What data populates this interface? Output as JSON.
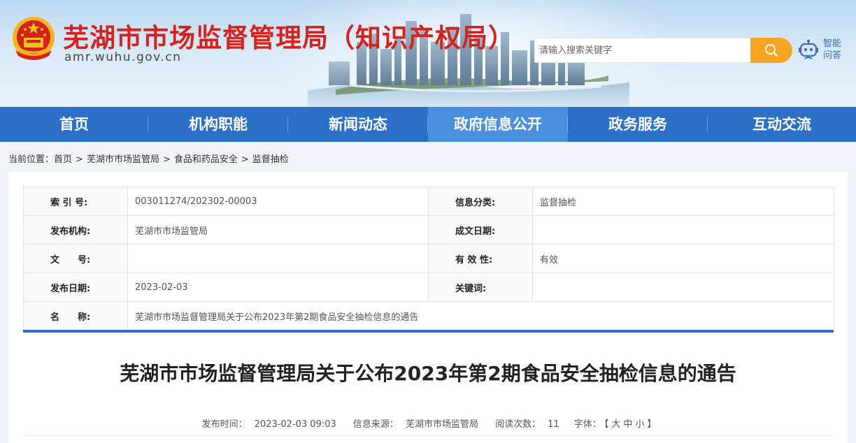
{
  "header": {
    "site_title": "芜湖市市场监督管理局（知识产权局）",
    "site_domain": "amr.wuhu.gov.cn",
    "search_placeholder": "请输入搜索关键字",
    "smart_qa_label": "智能问答",
    "icons": [
      "national-emblem-icon",
      "search-icon",
      "robot-icon"
    ]
  },
  "nav": {
    "items": [
      {
        "label": "首页"
      },
      {
        "label": "机构职能"
      },
      {
        "label": "新闻动态"
      },
      {
        "label": "政府信息公开",
        "active": true
      },
      {
        "label": "政务服务"
      },
      {
        "label": "互动交流"
      }
    ]
  },
  "breadcrumb": {
    "prefix": "当前位置：",
    "items": [
      "首页",
      "芜湖市市场监管局",
      "食品和药品安全",
      "监督抽检"
    ],
    "separator": ">"
  },
  "info_table": {
    "rows": [
      {
        "label1": "索 引 号:",
        "value1": "003011274/202302-00003",
        "label2": "信息分类:",
        "value2": "监督抽检"
      },
      {
        "label1": "发布机构:",
        "value1": "芜湖市市场监管局",
        "label2": "成文日期:",
        "value2": ""
      },
      {
        "label1": "文　　号:",
        "value1": "",
        "label2": "有 效 性:",
        "value2": "有效"
      },
      {
        "label1": "发布日期:",
        "value1": "2023-02-03",
        "label2": "关键词:",
        "value2": ""
      }
    ],
    "name_label": "名　　称:",
    "name_value": "芜湖市市场监督管理局关于公布2023年第2期食品安全抽检信息的通告"
  },
  "article": {
    "title": "芜湖市市场监督管理局关于公布2023年第2期食品安全抽检信息的通告",
    "publish_time_label": "发布时间：",
    "publish_time": "2023-02-03 09:03",
    "source_label": "信息来源：",
    "source": "芜湖市市场监管局",
    "views_label": "阅读次数：",
    "views": "11",
    "font_label": "字体：",
    "font_open": "【",
    "font_large": "大",
    "font_medium": "中",
    "font_small": "小",
    "font_close": "】"
  },
  "colors": {
    "nav_bg": "#2b6fc7",
    "nav_active": "#4a8fdd",
    "title_red": "#d6221d",
    "search_btn": "#f6a623"
  }
}
